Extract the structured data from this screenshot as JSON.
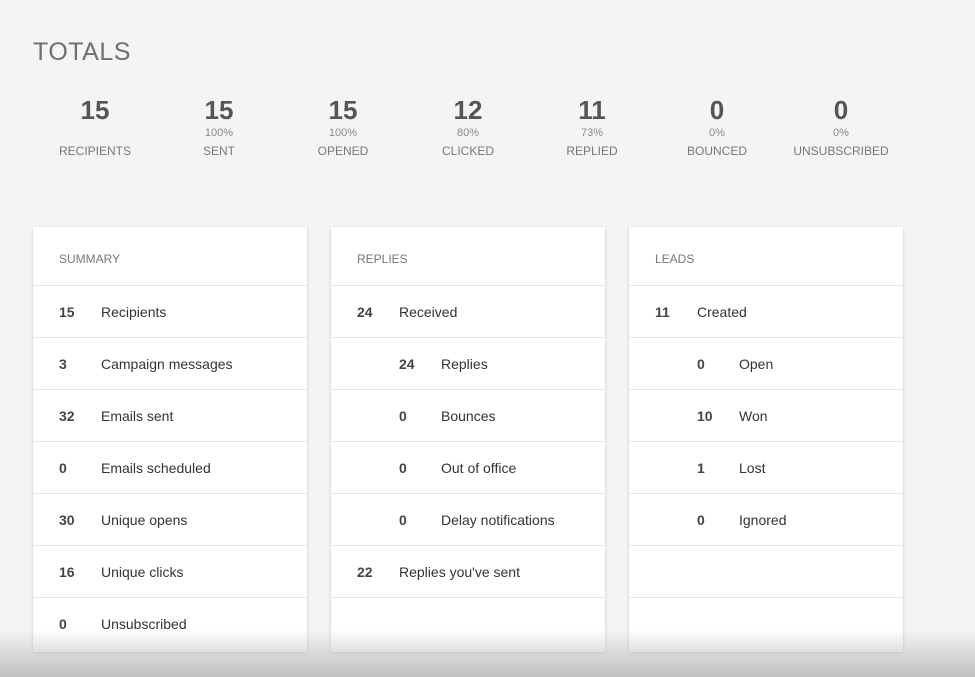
{
  "totals": {
    "title": "TOTALS",
    "stats": [
      {
        "value": "15",
        "pct": "",
        "label": "RECIPIENTS"
      },
      {
        "value": "15",
        "pct": "100%",
        "label": "SENT"
      },
      {
        "value": "15",
        "pct": "100%",
        "label": "OPENED"
      },
      {
        "value": "12",
        "pct": "80%",
        "label": "CLICKED"
      },
      {
        "value": "11",
        "pct": "73%",
        "label": "REPLIED"
      },
      {
        "value": "0",
        "pct": "0%",
        "label": "BOUNCED"
      },
      {
        "value": "0",
        "pct": "0%",
        "label": "UNSUBSCRIBED"
      }
    ]
  },
  "summary": {
    "header": "SUMMARY",
    "rows": [
      {
        "num": "15",
        "label": "Recipients"
      },
      {
        "num": "3",
        "label": "Campaign messages"
      },
      {
        "num": "32",
        "label": "Emails sent"
      },
      {
        "num": "0",
        "label": "Emails scheduled"
      },
      {
        "num": "30",
        "label": "Unique opens"
      },
      {
        "num": "16",
        "label": "Unique clicks"
      },
      {
        "num": "0",
        "label": "Unsubscribed"
      }
    ]
  },
  "replies": {
    "header": "REPLIES",
    "rows": [
      {
        "num": "24",
        "label": "Received"
      },
      {
        "num": "24",
        "label": "Replies"
      },
      {
        "num": "0",
        "label": "Bounces"
      },
      {
        "num": "0",
        "label": "Out of office"
      },
      {
        "num": "0",
        "label": "Delay notifications"
      },
      {
        "num": "22",
        "label": "Replies you've sent"
      }
    ]
  },
  "leads": {
    "header": "LEADS",
    "rows": [
      {
        "num": "11",
        "label": "Created"
      },
      {
        "num": "0",
        "label": "Open"
      },
      {
        "num": "10",
        "label": "Won"
      },
      {
        "num": "1",
        "label": "Lost"
      },
      {
        "num": "0",
        "label": "Ignored"
      }
    ]
  }
}
